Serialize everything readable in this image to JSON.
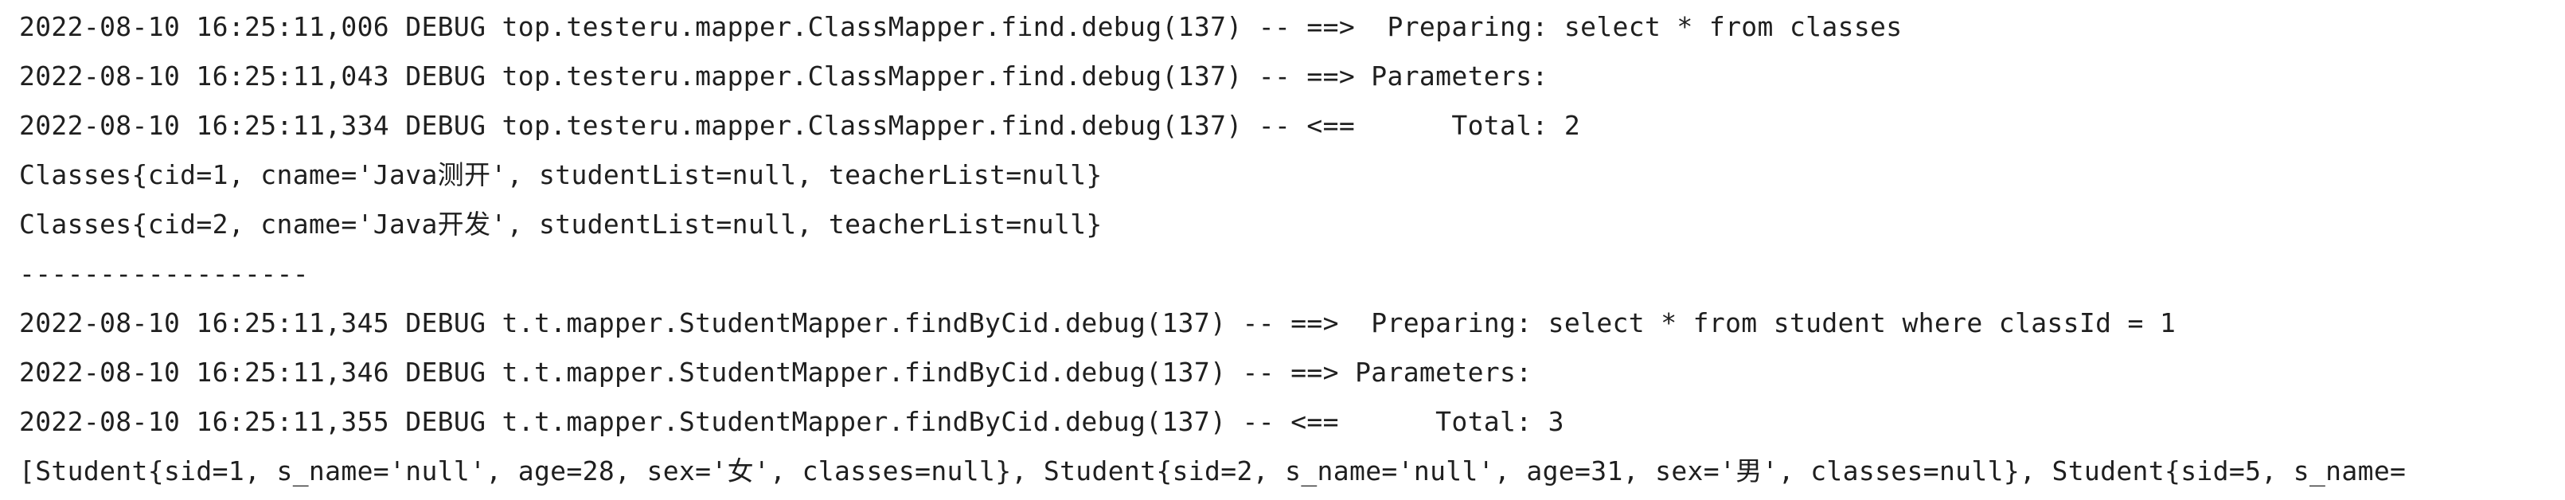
{
  "console": {
    "lines": [
      "2022-08-10 16:25:11,006 DEBUG top.testeru.mapper.ClassMapper.find.debug(137) -- ==>  Preparing: select * from classes",
      "2022-08-10 16:25:11,043 DEBUG top.testeru.mapper.ClassMapper.find.debug(137) -- ==> Parameters: ",
      "2022-08-10 16:25:11,334 DEBUG top.testeru.mapper.ClassMapper.find.debug(137) -- <==      Total: 2",
      "Classes{cid=1, cname='Java测开', studentList=null, teacherList=null}",
      "Classes{cid=2, cname='Java开发', studentList=null, teacherList=null}",
      "------------------",
      "2022-08-10 16:25:11,345 DEBUG t.t.mapper.StudentMapper.findByCid.debug(137) -- ==>  Preparing: select * from student where classId = 1",
      "2022-08-10 16:25:11,346 DEBUG t.t.mapper.StudentMapper.findByCid.debug(137) -- ==> Parameters: ",
      "2022-08-10 16:25:11,355 DEBUG t.t.mapper.StudentMapper.findByCid.debug(137) -- <==      Total: 3",
      "[Student{sid=1, s_name='null', age=28, sex='女', classes=null}, Student{sid=2, s_name='null', age=31, sex='男', classes=null}, Student{sid=5, s_name="
    ]
  }
}
